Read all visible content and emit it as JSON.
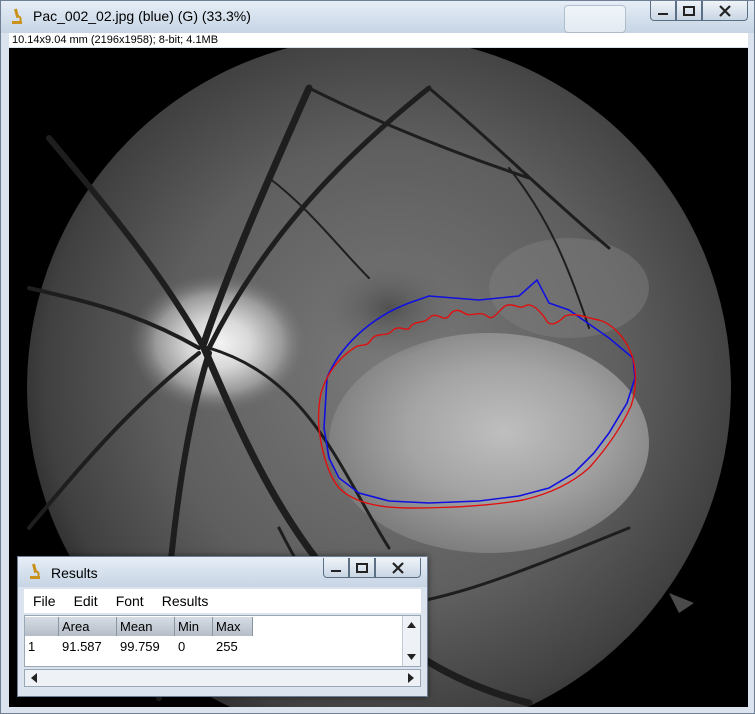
{
  "window": {
    "title": "Pac_002_02.jpg (blue) (G) (33.3%)",
    "info": "10.14x9.04 mm (2196x1958); 8-bit; 4.1MB"
  },
  "image": {
    "description_icon": "fundus-image",
    "contour_colors": {
      "blue": "#1010e0",
      "red": "#e01010"
    }
  },
  "results": {
    "title": "Results",
    "menu": [
      "File",
      "Edit",
      "Font",
      "Results"
    ],
    "columns": [
      "",
      "Area",
      "Mean",
      "Min",
      "Max"
    ],
    "rows": [
      {
        "index": "1",
        "area": "91.587",
        "mean": "99.759",
        "min": "0",
        "max": "255"
      }
    ]
  }
}
